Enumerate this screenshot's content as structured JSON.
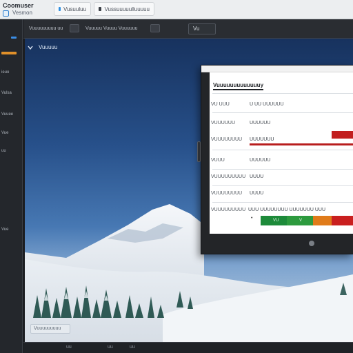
{
  "window": {
    "title": "Coomuser",
    "subtitle": "Vesmon"
  },
  "chrome_tabs": [
    {
      "label": "Vusuuluu"
    },
    {
      "label": "Vussuuuuulluuuuu"
    }
  ],
  "sidebar": {
    "items": [
      {
        "label": "ieuo"
      },
      {
        "label": "Vulsa"
      },
      {
        "label": "Vuuee"
      },
      {
        "label": "Vue"
      },
      {
        "label": "uu"
      },
      {
        "label": "Vue"
      }
    ]
  },
  "toolbar": {
    "label_left": "Vuuuuuuuuu uu",
    "label_mid": "Vuuuuu Vuuuu Vuuuuuu",
    "group_label": "Vu"
  },
  "viewport": {
    "breadcrumb": "Vuuuuu",
    "status_chip": "Vuuuuuuuuu"
  },
  "dialog": {
    "heading": "Vuuuuuuuuuuuuuy",
    "rows": [
      {
        "label": "VU UUU",
        "value": "U UU UUUUUU"
      },
      {
        "label": "VUUUUUU",
        "value": "UUUUUU"
      },
      {
        "label": "VUUUUUUUU",
        "value": "UUUUUUU"
      },
      {
        "label": "VUUU",
        "value": "UUUUUU"
      },
      {
        "label": "VUUUUUUUUU",
        "value": "UUUU"
      },
      {
        "label": "VUUUUUUUU",
        "value": "UUUU"
      },
      {
        "label": "VUUUUUUUUU",
        "value": "UUU UUUUUUUU UUUUUUU UUU"
      }
    ],
    "traffic_segments": [
      {
        "label": "VU",
        "color": "#1d8a3a",
        "share": 0.28
      },
      {
        "label": "V",
        "color": "#2d9a3e",
        "share": 0.28
      },
      {
        "label": "",
        "color": "#e07b1a",
        "share": 0.2
      },
      {
        "label": "",
        "color": "#c91f1f",
        "share": 0.24
      }
    ],
    "small_mark": "•"
  },
  "statusbar": {
    "items": [
      {
        "label": "uu"
      },
      {
        "label": "uu"
      },
      {
        "label": "uu"
      }
    ]
  },
  "colors": {
    "accent_orange": "#e0902a",
    "accent_blue": "#3b8ee6",
    "alert_red": "#c21f1f"
  }
}
